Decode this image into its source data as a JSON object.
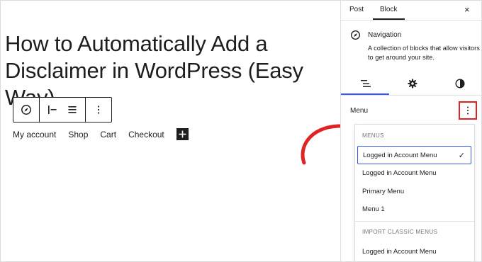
{
  "editor": {
    "title": "How to Automatically Add a Disclaimer in WordPress (Easy Way)",
    "block_toolbar": {
      "block_icon": "compass-icon",
      "justify_left_icon": "justify-left-icon",
      "justify_center_icon": "justify-center-icon",
      "options_icon": "more-vertical-icon"
    },
    "nav_links": [
      "My account",
      "Shop",
      "Cart",
      "Checkout"
    ],
    "add_icon": "plus-icon"
  },
  "sidebar": {
    "tabs": {
      "post": "Post",
      "block": "Block"
    },
    "close_label": "×",
    "block_card": {
      "icon": "compass-icon",
      "title": "Navigation",
      "description": "A collection of blocks that allow visitors to get around your site."
    },
    "subtabs": [
      "list-view-icon",
      "gear-icon",
      "styles-icon"
    ],
    "menu_label": "Menu",
    "dropdown": {
      "menus_heading": "MENUS",
      "menus": [
        "Logged in Account Menu",
        "Logged in Account Menu",
        "Primary Menu",
        "Menu 1"
      ],
      "selected_index": 0,
      "check": "✓",
      "import_heading": "IMPORT CLASSIC MENUS",
      "classic_menus": [
        "Logged in Account Menu"
      ]
    }
  },
  "colors": {
    "highlight_box": "#e02424",
    "arrow": "#e02424",
    "accent": "#3858e9",
    "text": "#1e1e1e"
  }
}
